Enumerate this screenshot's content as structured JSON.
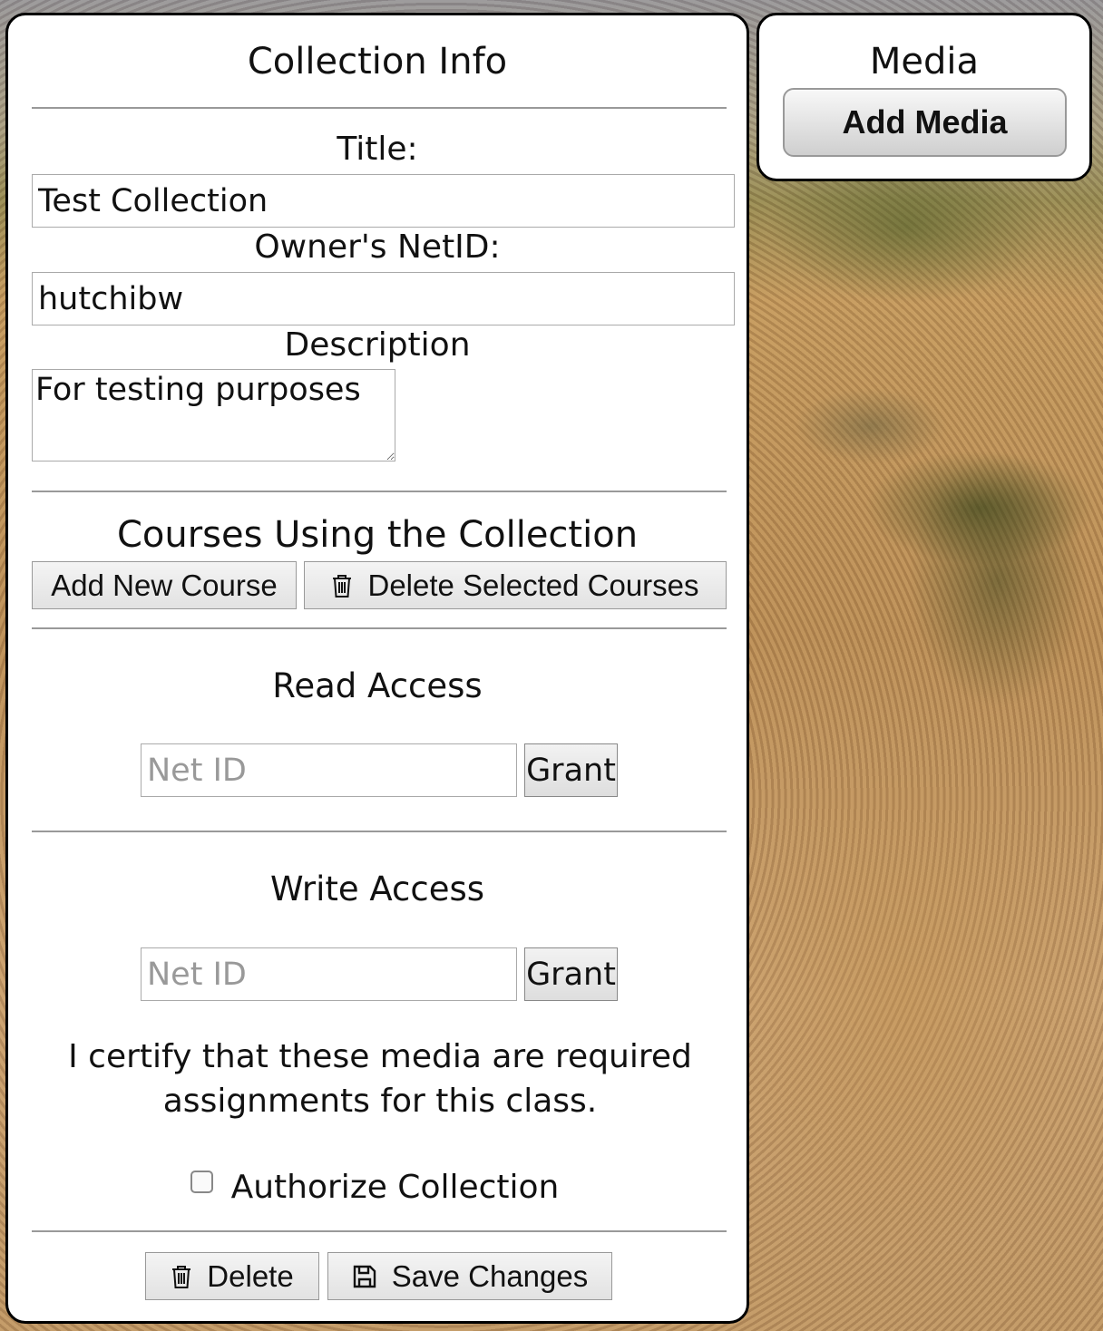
{
  "collection_info": {
    "heading": "Collection Info",
    "title_label": "Title:",
    "title_value": "Test Collection",
    "owner_label": "Owner's NetID:",
    "owner_value": "hutchibw",
    "description_label": "Description",
    "description_value": "For testing purposes"
  },
  "courses": {
    "heading": "Courses Using the Collection",
    "add_button": "Add New Course",
    "delete_button": "Delete Selected Courses",
    "delete_icon": "trash-icon"
  },
  "read_access": {
    "heading": "Read Access",
    "placeholder": "Net ID",
    "grant_button": "Grant"
  },
  "write_access": {
    "heading": "Write Access",
    "placeholder": "Net ID",
    "grant_button": "Grant"
  },
  "certification": {
    "text": "I certify that these media are required assignments for this class.",
    "checkbox_label": "Authorize Collection",
    "checked": false
  },
  "footer": {
    "delete_button": "Delete",
    "delete_icon": "trash-icon",
    "save_button": "Save Changes",
    "save_icon": "floppy-disk-icon"
  },
  "media": {
    "heading": "Media",
    "add_button": "Add Media"
  }
}
